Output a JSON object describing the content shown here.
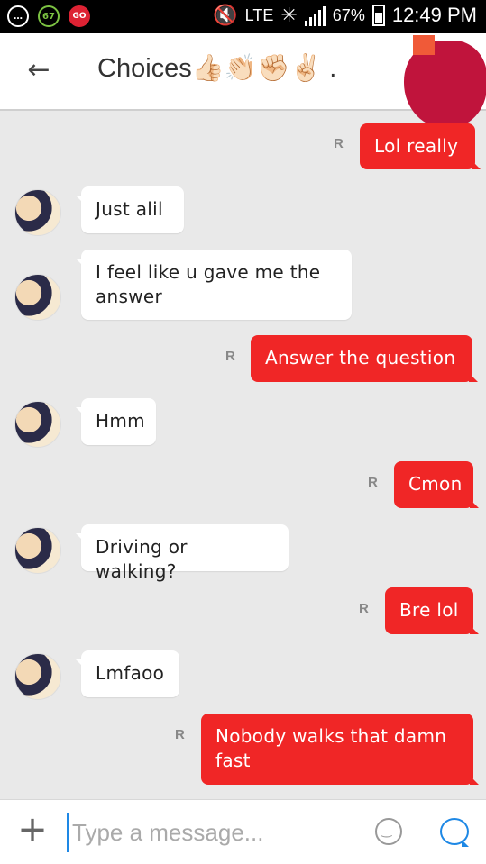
{
  "status_bar": {
    "badge_count": "67",
    "go_badge": "GO",
    "network": "LTE",
    "battery": "67%",
    "time": "12:49 PM"
  },
  "header": {
    "back_icon": "arrow-left",
    "title": "Choices👍🏻👏🏻✊🏻✌🏻 ."
  },
  "receipt_marker": "R",
  "messages": [
    {
      "direction": "out",
      "text": "Lol really"
    },
    {
      "direction": "in",
      "text": "Just alil"
    },
    {
      "direction": "in",
      "text": "I feel like u gave me the answer"
    },
    {
      "direction": "out",
      "text": "Answer the question"
    },
    {
      "direction": "in",
      "text": "Hmm"
    },
    {
      "direction": "out",
      "text": "Cmon"
    },
    {
      "direction": "in",
      "text": "Driving or walking?"
    },
    {
      "direction": "out",
      "text": "Bre lol"
    },
    {
      "direction": "in",
      "text": "Lmfaoo"
    },
    {
      "direction": "out",
      "text": "Nobody walks that damn fast"
    }
  ],
  "composer": {
    "placeholder": "Type a message...",
    "add_icon": "plus",
    "emoji_icon": "smiley",
    "send_icon": "chat-bubble"
  },
  "colors": {
    "outgoing_bubble": "#f02626",
    "incoming_bubble": "#ffffff",
    "accent": "#1e88e5",
    "background": "#e9e9e9"
  }
}
